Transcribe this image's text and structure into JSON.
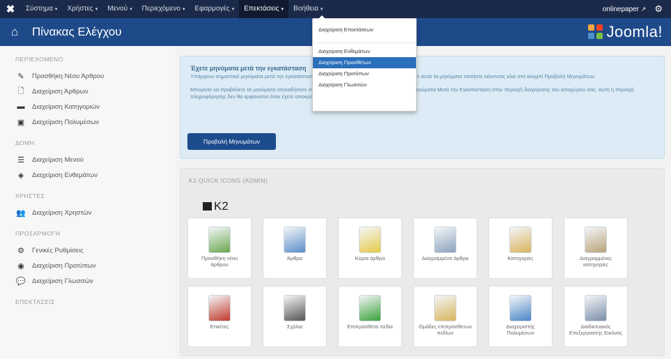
{
  "topnav": {
    "items": [
      {
        "label": "Σύστημα"
      },
      {
        "label": "Χρήστες"
      },
      {
        "label": "Μενού"
      },
      {
        "label": "Περιεχόμενο"
      },
      {
        "label": "Εφαρμογές"
      },
      {
        "label": "Επεκτάσεις"
      },
      {
        "label": "Βοήθεια"
      }
    ],
    "caret": "▾",
    "site": "onlinepaper",
    "external_icon": "external-link-icon",
    "gear_icon": "gear-icon"
  },
  "header": {
    "home_icon": "home-icon",
    "title": "Πίνακας Ελέγχου",
    "brand": "Joomla!"
  },
  "dropdown": {
    "items": [
      {
        "label": "Διαχείριση Επεκτάσεων"
      },
      {
        "label": "Διαχείριση Ενθεμάτων"
      },
      {
        "label": "Διαχείριση Προσθέτων"
      },
      {
        "label": "Διαχείριση Προτύπων"
      },
      {
        "label": "Διαχείριση Γλωσσών"
      }
    ],
    "highlighted_index": 2
  },
  "sidebar": {
    "groups": [
      {
        "heading": "ΠΕΡΙΕΧΟΜΕΝΟ",
        "items": [
          {
            "label": "Προσθήκη Νέου Άρθρου",
            "icon": "pencil-icon"
          },
          {
            "label": "Διαχείριση Άρθρων",
            "icon": "document-icon"
          },
          {
            "label": "Διαχείριση Κατηγοριών",
            "icon": "folder-icon"
          },
          {
            "label": "Διαχείριση Πολυμέσων",
            "icon": "image-icon"
          }
        ]
      },
      {
        "heading": "ΔΟΜΗ",
        "items": [
          {
            "label": "Διαχείριση Μενού",
            "icon": "list-icon"
          },
          {
            "label": "Διαχείριση Ενθεμάτων",
            "icon": "cube-icon"
          }
        ]
      },
      {
        "heading": "ΧΡΗΣΤΕΣ",
        "items": [
          {
            "label": "Διαχείριση Χρηστών",
            "icon": "users-icon"
          }
        ]
      },
      {
        "heading": "ΠΡΟΣΑΡΜΟΓΗ",
        "items": [
          {
            "label": "Γενικές Ρυθμίσεις",
            "icon": "cog-icon"
          },
          {
            "label": "Διαχείριση Προτύπων",
            "icon": "eye-icon"
          },
          {
            "label": "Διαχείριση Γλωσσών",
            "icon": "comments-icon"
          }
        ]
      },
      {
        "heading": "ΕΠΕΚΤΑΣΕΙΣ",
        "items": []
      }
    ]
  },
  "alert": {
    "title": "Έχετε μηνύματα μετά την εγκατάσταση",
    "p1": "Υπάρχουν σημαντικά μηνύματα μετά την εγκατάσταση που απαιτούν την προσοχή σας. Για να δείτε αυτά τα μηνύματα πατήστε κάνοντας κλικ στο κουμπί Προβολή Μηνυμάτων.",
    "p2": "Μπορείτε να προβάλετε τα μηνύματα οποιαδήποτε στιγμή κάνοντας κλικ στο μενού Εφαρμογές, Μηνύματα Μετά την Εγκατάσταση στην περιοχή διαχείρισης του ιστοχώρου σας. Αυτή η περιοχή πληροφόρησης δεν θα εμφανιστεί όταν έχετε αποκρύψει όλα τα μηνύματα.",
    "button": "Προβολή Μηνυμάτων"
  },
  "quick": {
    "heading": "K2 QUICK ICONS (ADMIN)",
    "k2_label": "K2",
    "tiles": [
      {
        "label": "Προσθήκη νέου άρθρου",
        "icon": "add-document-icon",
        "color": "#6aa84f"
      },
      {
        "label": "Άρθρα",
        "icon": "documents-icon",
        "color": "#5b8ec9"
      },
      {
        "label": "Κύρια άρθρα",
        "icon": "featured-icon",
        "color": "#e6c94a"
      },
      {
        "label": "Διαγραμμένα άρθρα",
        "icon": "trash-documents-icon",
        "color": "#8aa3bd"
      },
      {
        "label": "Κατηγορίες",
        "icon": "folders-icon",
        "color": "#d9b55e"
      },
      {
        "label": "Διαγραμμένες κατηγορίες",
        "icon": "trash-folders-icon",
        "color": "#b8a47a"
      },
      {
        "label": "Ετικέτες",
        "icon": "bookmark-icon",
        "color": "#c0392b"
      },
      {
        "label": "Σχόλια",
        "icon": "speech-bubbles-icon",
        "color": "#555555"
      },
      {
        "label": "Επιπρόσθετα πεδία",
        "icon": "extra-fields-icon",
        "color": "#3aa13a"
      },
      {
        "label": "Ομάδες επιπρόσθετων πεδίων",
        "icon": "field-groups-icon",
        "color": "#d9b55e"
      },
      {
        "label": "Διαχειριστής Πολυμέσων",
        "icon": "media-manager-icon",
        "color": "#4a86c8"
      },
      {
        "label": "Διαδικτυακός Επεξεργαστής Εικόνας",
        "icon": "image-editor-icon",
        "color": "#7a8ea8"
      }
    ]
  }
}
